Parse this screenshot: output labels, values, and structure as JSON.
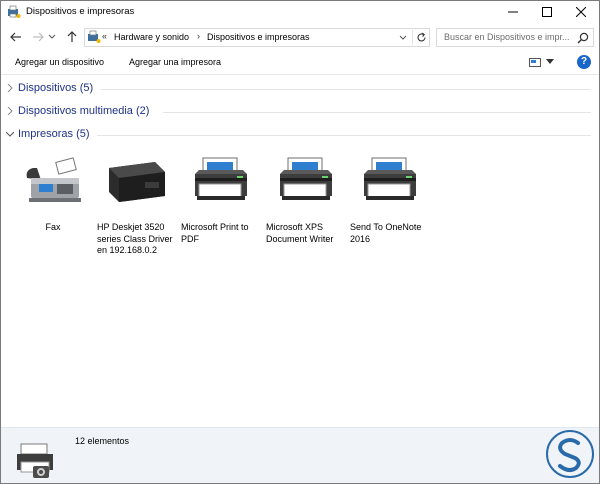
{
  "window": {
    "title": "Dispositivos e impresoras"
  },
  "address": {
    "overflow": "«",
    "crumbs": [
      "Hardware y sonido",
      "Dispositivos e impresoras"
    ],
    "separator": "›"
  },
  "search": {
    "placeholder": "Buscar en Dispositivos e impr..."
  },
  "commands": {
    "add_device": "Agregar un dispositivo",
    "add_printer": "Agregar una impresora"
  },
  "groups": [
    {
      "label": "Dispositivos (5)",
      "expanded": false
    },
    {
      "label": "Dispositivos multimedia (2)",
      "expanded": false
    },
    {
      "label": "Impresoras (5)",
      "expanded": true
    }
  ],
  "printers": [
    {
      "label": "Fax",
      "icon": "fax-icon"
    },
    {
      "label": "HP Deskjet 3520 series Class Driver en 192.168.0.2",
      "icon": "hp-printer-icon"
    },
    {
      "label": "Microsoft Print to PDF",
      "icon": "printer-icon"
    },
    {
      "label": "Microsoft XPS Document Writer",
      "icon": "printer-icon"
    },
    {
      "label": "Send To OneNote 2016",
      "icon": "printer-icon"
    }
  ],
  "details": {
    "count": "12 elementos"
  },
  "colors": {
    "group_text": "#1e3287",
    "details_bg": "#f0f4f9",
    "help": "#1b67c9",
    "logo": "#2b6aa8"
  },
  "logo": {
    "text": "S"
  }
}
